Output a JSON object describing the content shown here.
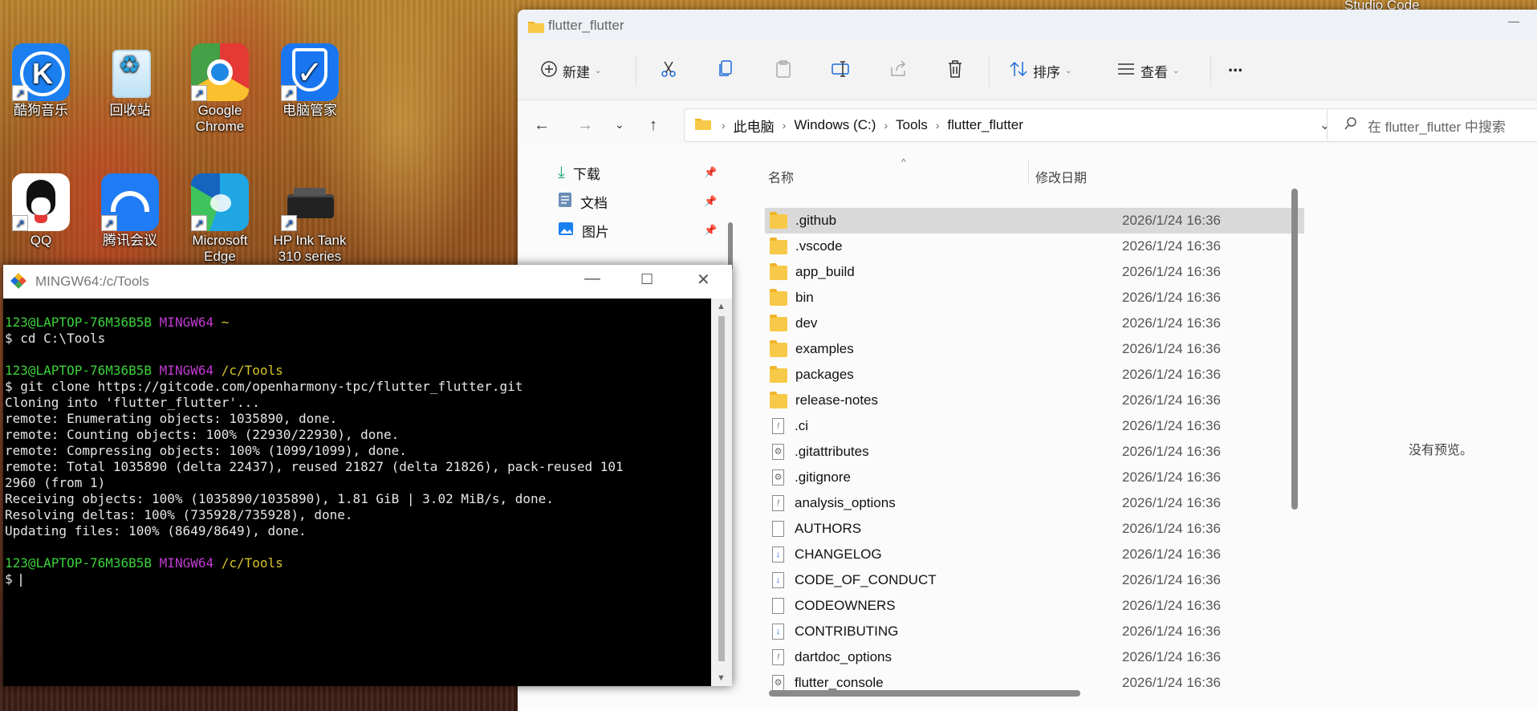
{
  "desktop": {
    "studio_label": "Studio Code",
    "icons": [
      {
        "label": "酷狗音乐"
      },
      {
        "label": "回收站"
      },
      {
        "label": "Google Chrome"
      },
      {
        "label": "电脑管家"
      },
      {
        "label": "QQ"
      },
      {
        "label": "腾讯会议"
      },
      {
        "label": "Microsoft Edge"
      },
      {
        "label": "HP Ink Tank 310 series"
      }
    ]
  },
  "explorer": {
    "title": "flutter_flutter",
    "toolbar": {
      "new_label": "新建",
      "sort_label": "排序",
      "view_label": "查看",
      "more_label": "..."
    },
    "breadcrumb": [
      "此电脑",
      "Windows (C:)",
      "Tools",
      "flutter_flutter"
    ],
    "search_placeholder": "在 flutter_flutter 中搜索",
    "nav_items": [
      {
        "label": "下载"
      },
      {
        "label": "文档"
      },
      {
        "label": "图片"
      }
    ],
    "columns": {
      "name": "名称",
      "date": "修改日期"
    },
    "files": [
      {
        "name": ".github",
        "date": "2026/1/24 16:36",
        "type": "folder"
      },
      {
        "name": ".vscode",
        "date": "2026/1/24 16:36",
        "type": "folder"
      },
      {
        "name": "app_build",
        "date": "2026/1/24 16:36",
        "type": "folder"
      },
      {
        "name": "bin",
        "date": "2026/1/24 16:36",
        "type": "folder"
      },
      {
        "name": "dev",
        "date": "2026/1/24 16:36",
        "type": "folder"
      },
      {
        "name": "examples",
        "date": "2026/1/24 16:36",
        "type": "folder"
      },
      {
        "name": "packages",
        "date": "2026/1/24 16:36",
        "type": "folder"
      },
      {
        "name": "release-notes",
        "date": "2026/1/24 16:36",
        "type": "folder"
      },
      {
        "name": ".ci",
        "date": "2026/1/24 16:36",
        "type": "warn"
      },
      {
        "name": ".gitattributes",
        "date": "2026/1/24 16:36",
        "type": "gear"
      },
      {
        "name": ".gitignore",
        "date": "2026/1/24 16:36",
        "type": "gear"
      },
      {
        "name": "analysis_options",
        "date": "2026/1/24 16:36",
        "type": "warn"
      },
      {
        "name": "AUTHORS",
        "date": "2026/1/24 16:36",
        "type": "doc"
      },
      {
        "name": "CHANGELOG",
        "date": "2026/1/24 16:36",
        "type": "down"
      },
      {
        "name": "CODE_OF_CONDUCT",
        "date": "2026/1/24 16:36",
        "type": "down"
      },
      {
        "name": "CODEOWNERS",
        "date": "2026/1/24 16:36",
        "type": "doc"
      },
      {
        "name": "CONTRIBUTING",
        "date": "2026/1/24 16:36",
        "type": "down"
      },
      {
        "name": "dartdoc_options",
        "date": "2026/1/24 16:36",
        "type": "warn"
      },
      {
        "name": "flutter_console",
        "date": "2026/1/24 16:36",
        "type": "gear"
      }
    ],
    "preview_text": "没有预览。"
  },
  "terminal": {
    "title": "MINGW64:/c/Tools",
    "prompt1": {
      "user": "123@LAPTOP-76M36B5B",
      "host": "MINGW64",
      "path": "~"
    },
    "cmd1": "$ cd C:\\Tools",
    "prompt2": {
      "user": "123@LAPTOP-76M36B5B",
      "host": "MINGW64",
      "path": "/c/Tools"
    },
    "cmd2": "$ git clone https://gitcode.com/openharmony-tpc/flutter_flutter.git",
    "output": [
      "Cloning into 'flutter_flutter'...",
      "remote: Enumerating objects: 1035890, done.",
      "remote: Counting objects: 100% (22930/22930), done.",
      "remote: Compressing objects: 100% (1099/1099), done.",
      "remote: Total 1035890 (delta 22437), reused 21827 (delta 21826), pack-reused 101",
      "2960 (from 1)",
      "Receiving objects: 100% (1035890/1035890), 1.81 GiB | 3.02 MiB/s, done.",
      "Resolving deltas: 100% (735928/735928), done.",
      "Updating files: 100% (8649/8649), done."
    ],
    "prompt3": {
      "user": "123@LAPTOP-76M36B5B",
      "host": "MINGW64",
      "path": "/c/Tools"
    },
    "cmd3": "$ "
  }
}
